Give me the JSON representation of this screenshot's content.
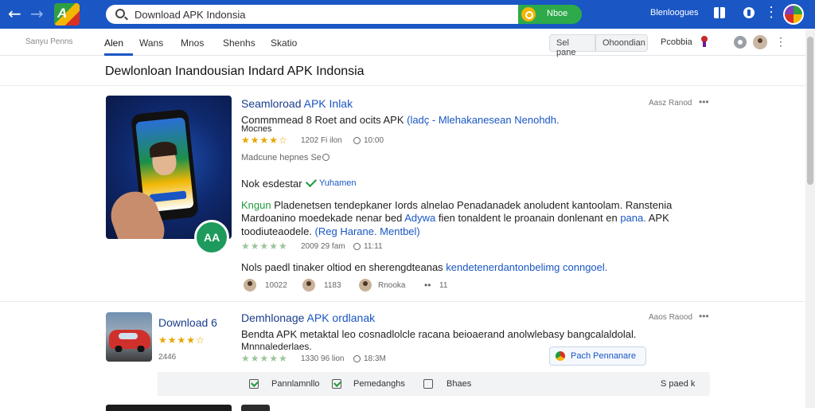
{
  "topbar": {
    "search_value": "Download APK Indonsia",
    "search_button": "Nboe",
    "language": "Blenloogues"
  },
  "nav": {
    "brand": "Sanyu Penns",
    "tabs": [
      "Alen",
      "Wans",
      "Mnos",
      "Shenhs",
      "Skatio"
    ],
    "btn_left": "Sel pane",
    "btn_right": "Ohoondian",
    "right_label": "Pcobbia"
  },
  "heading": "Dewlonloan Inandousian Indard APK Indonsia",
  "card1": {
    "title_a": "Seamloroad ",
    "title_b": "APK Inlak",
    "meta_right": "Aasz Ranod",
    "line1_a": "Conmmmead 8 Roet and ocits APK ",
    "line1_b": "(ladç - Mlehakanesean Nenohdh.",
    "line2": "Mocnes",
    "rating1_stars": "★★★★☆",
    "rating1_count": "1202 Fi ilon",
    "rating1_time": "10:00",
    "line3": "Madcune hepnes Se",
    "label_title": "Nok esdestar",
    "label_tag": "Yuhamen",
    "para1_a": "Kngun ",
    "para1_b": "Pladenetsen tendepkaner Iords alnelao Penadanadek anoludent kantoolam. Ranstenia",
    "para2_a": "Mardoanino moedekade nenar bed ",
    "para2_b": "Adywa ",
    "para2_c": "fien tonaldent le proanain donlenant en ",
    "para2_d": "pana. ",
    "para2_e": "APK",
    "para3_a": "toodiuteaodele. ",
    "para3_b": "(Reg Harane. Mentbel)",
    "rating2_stars": "★★★★★",
    "rating2_count": "2009 29 fam",
    "rating2_time": "11:11",
    "line4_a": "Nols paedl tinaker oltiod en sherengdteanas ",
    "line4_b": "kendetenerdantonbelimg conngoel.",
    "people": [
      {
        "label": "10022"
      },
      {
        "label": "1183"
      },
      {
        "label": "Rnooka"
      }
    ],
    "people_more": "11"
  },
  "card2": {
    "thumb_label": "Download 6",
    "thumb_stars": "★★★★☆",
    "thumb_count": "2446",
    "title_a": "Demhlonage ",
    "title_b": "APK ordlanak",
    "meta_right": "Aaos Raood",
    "line1": "Bendta APK metaktal leo cosnadlolcle racana beioaerand anolwlebasy bangcalaldolal.",
    "line2": "Mnnnalederlaes.",
    "rating_stars": "★★★★★",
    "rating_count": "1330 96 lion",
    "rating_time": "18:3M",
    "chip": "Pach Pennanare"
  },
  "panel": {
    "checks": [
      {
        "label": "Pannlamnllo",
        "checked": true
      },
      {
        "label": "Pemedanghs",
        "checked": true
      },
      {
        "label": "Bhaes",
        "checked": false
      }
    ],
    "right": "S paed k"
  }
}
